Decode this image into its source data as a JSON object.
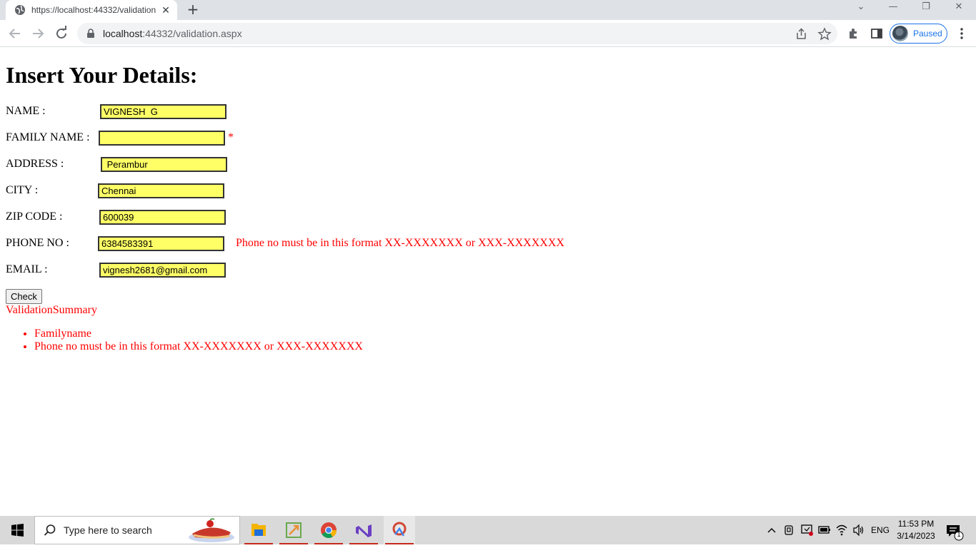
{
  "browser": {
    "tab_title": "https://localhost:44332/validation",
    "url_host": "localhost",
    "url_rest": ":44332/validation.aspx",
    "profile_label": "Paused"
  },
  "form": {
    "heading": "Insert Your Details:",
    "fields": [
      {
        "label": "NAME :",
        "value": "VIGNESH  G"
      },
      {
        "label": "FAMILY NAME :",
        "value": ""
      },
      {
        "label": "ADDRESS :",
        "value": " Perambur"
      },
      {
        "label": "CITY :",
        "value": "Chennai"
      },
      {
        "label": "ZIP CODE :",
        "value": "600039"
      },
      {
        "label": "PHONE NO :",
        "value": "6384583391"
      },
      {
        "label": "EMAIL :",
        "value": "vignesh2681@gmail.com"
      }
    ],
    "required_marker": "*",
    "phone_error": "Phone no must be in this format XX-XXXXXXX or XXX-XXXXXXX",
    "check_button": "Check",
    "summary_title": "ValidationSummary",
    "summary_items": [
      "Familyname",
      "Phone no must be in this format XX-XXXXXXX or XXX-XXXXXXX"
    ]
  },
  "taskbar": {
    "search_placeholder": "Type here to search",
    "language": "ENG",
    "time": "11:53 PM",
    "date": "3/14/2023",
    "notification_count": "1",
    "apps": [
      "file-explorer-icon",
      "app-icon",
      "chrome-icon",
      "visual-studio-icon",
      "app-icon-2"
    ]
  },
  "colors": {
    "field_bg": "#ffff66",
    "error": "#ff0000",
    "accent": "#1a73e8"
  }
}
